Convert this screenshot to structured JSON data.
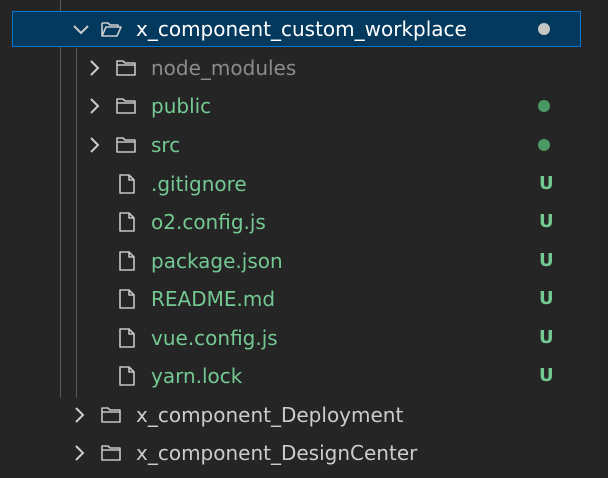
{
  "colors": {
    "background": "#252526",
    "selected_bg": "#04395e",
    "selected_border": "#0078d4",
    "text_default": "#cccccc",
    "text_white": "#ffffff",
    "text_ignored": "#8c8c8c",
    "text_untracked": "#73c991",
    "badge_modified_dot": "#c5c5c5",
    "badge_untracked_dot": "#4b9a64",
    "badge_untracked_letter": "#73c991"
  },
  "explorer": {
    "rows": [
      {
        "label": "x_component_custom_workplace",
        "type": "folder",
        "expanded": true,
        "decoration": "dot",
        "selected": true
      },
      {
        "label": "node_modules",
        "type": "folder",
        "expanded": false,
        "decoration": "",
        "status": "ignored"
      },
      {
        "label": "public",
        "type": "folder",
        "expanded": false,
        "decoration": "dot",
        "status": "untracked"
      },
      {
        "label": "src",
        "type": "folder",
        "expanded": false,
        "decoration": "dot",
        "status": "untracked"
      },
      {
        "label": ".gitignore",
        "type": "file",
        "decoration": "U",
        "status": "untracked"
      },
      {
        "label": "o2.config.js",
        "type": "file",
        "decoration": "U",
        "status": "untracked"
      },
      {
        "label": "package.json",
        "type": "file",
        "decoration": "U",
        "status": "untracked"
      },
      {
        "label": "README.md",
        "type": "file",
        "decoration": "U",
        "status": "untracked"
      },
      {
        "label": "vue.config.js",
        "type": "file",
        "decoration": "U",
        "status": "untracked"
      },
      {
        "label": "yarn.lock",
        "type": "file",
        "decoration": "U",
        "status": "untracked"
      },
      {
        "label": "x_component_Deployment",
        "type": "folder",
        "expanded": false,
        "decoration": ""
      },
      {
        "label": "x_component_DesignCenter",
        "type": "folder",
        "expanded": false,
        "decoration": ""
      }
    ]
  }
}
